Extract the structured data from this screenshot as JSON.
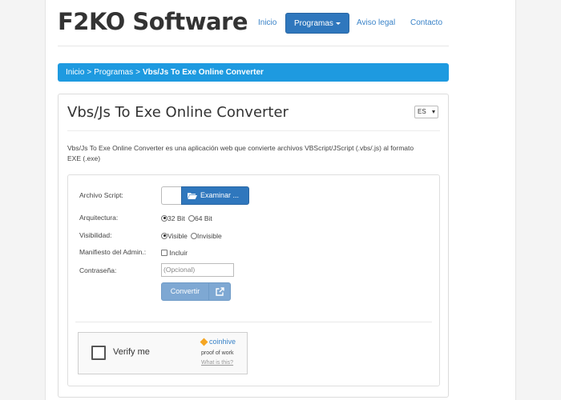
{
  "header": {
    "brand": "F2KO Software",
    "nav": {
      "inicio": "Inicio",
      "programas": "Programas",
      "aviso_legal": "Aviso legal",
      "contacto": "Contacto"
    }
  },
  "breadcrumb": {
    "home": "Inicio",
    "separator1": ">",
    "section": "Programas",
    "separator2": ">",
    "current": "Vbs/Js To Exe Online Converter"
  },
  "main": {
    "title": "Vbs/Js To Exe Online Converter",
    "language": "ES",
    "description": "Vbs/Js To Exe Online Converter es una aplicación web que convierte archivos VBScript/JScript (.vbs/.js) al formato EXE (.exe)"
  },
  "form": {
    "script_label": "Archivo Script:",
    "browse_label": "Examinar ...",
    "arch_label": "Arquitectura:",
    "arch_options": [
      "32 Bit",
      "64 Bit"
    ],
    "arch_selected": "32 Bit",
    "vis_label": "Visibilidad:",
    "vis_options": [
      "Visible",
      "Invisible"
    ],
    "vis_selected": "Visible",
    "admin_label": "Manifiesto del Admin.:",
    "admin_option": "Incluir",
    "admin_checked": false,
    "password_label": "Contraseña:",
    "password_placeholder": "(Opcional)",
    "convert_label": "Convertir"
  },
  "captcha": {
    "verify_label": "Verify me",
    "brand": "coinhive",
    "proof": "proof of work",
    "what": "What is this?"
  },
  "colors": {
    "accent": "#2f77bd",
    "breadcrumb_bg": "#1e9ae0",
    "convert_disabled": "#7ea8d3"
  }
}
